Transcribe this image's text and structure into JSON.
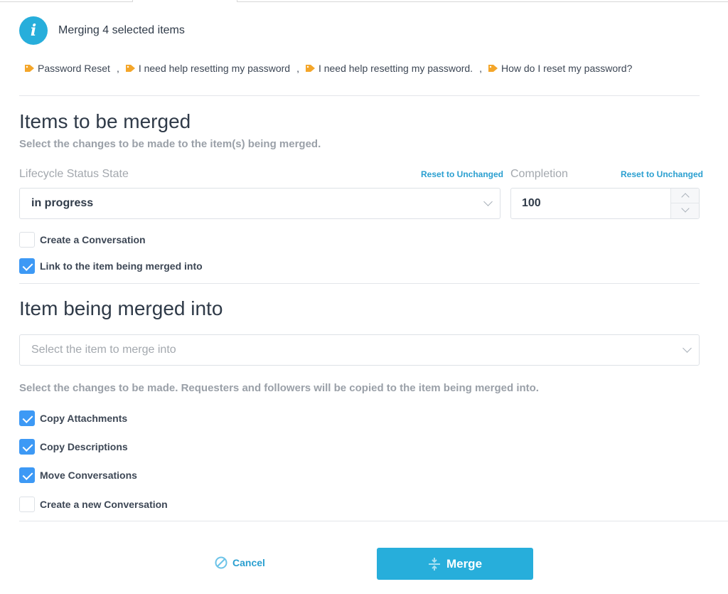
{
  "header": {
    "title": "Merging 4 selected items",
    "icon": "info-icon"
  },
  "tags": [
    {
      "label": "Password Reset",
      "icon": "tag-icon"
    },
    {
      "label": "I need help resetting my password",
      "icon": "tag-icon"
    },
    {
      "label": "I need help resetting my password.",
      "icon": "tag-icon"
    },
    {
      "label": "How do I reset my password?",
      "icon": "tag-icon"
    }
  ],
  "tag_separator": ",",
  "items_to_merge": {
    "title": "Items to be merged",
    "subtitle": "Select the changes to be made to the item(s) being merged.",
    "lifecycle": {
      "label": "Lifecycle Status State",
      "reset_label": "Reset to Unchanged",
      "value": "in progress"
    },
    "completion": {
      "label": "Completion",
      "reset_label": "Reset to Unchanged",
      "value": "100"
    },
    "options": [
      {
        "label": "Create a Conversation",
        "checked": false
      },
      {
        "label": "Link to the item being merged into",
        "checked": true
      }
    ]
  },
  "merge_target": {
    "title": "Item being merged into",
    "placeholder": "Select the item to merge into",
    "description": "Select the changes to be made. Requesters and followers will be copied to the item being merged into.",
    "options": [
      {
        "label": "Copy Attachments",
        "checked": true
      },
      {
        "label": "Copy Descriptions",
        "checked": true
      },
      {
        "label": "Move Conversations",
        "checked": true
      },
      {
        "label": "Create a new Conversation",
        "checked": false
      }
    ]
  },
  "footer": {
    "cancel_label": "Cancel",
    "merge_label": "Merge"
  },
  "colors": {
    "accent": "#27aedb",
    "link": "#2a9fd0",
    "checkbox_checked": "#3d99f5",
    "tag_icon": "#f4a62a"
  }
}
